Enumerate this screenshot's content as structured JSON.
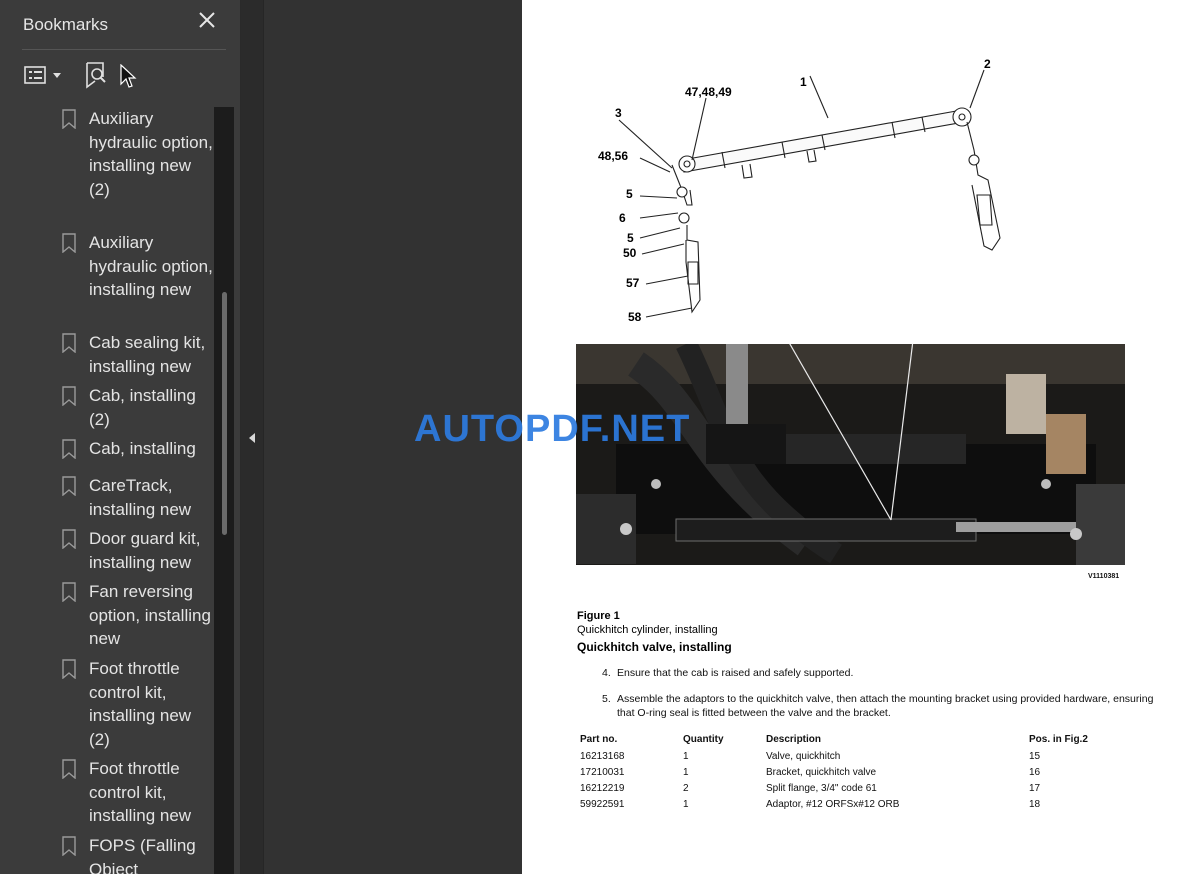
{
  "sidebar": {
    "title": "Bookmarks",
    "close_icon": "close-icon",
    "options_icon": "list-options-icon",
    "find_icon": "find-bookmark-icon",
    "items": [
      {
        "label": "Auxiliary hydraulic option, installing new (2)"
      },
      {
        "label": "Auxiliary hydraulic option, installing new"
      },
      {
        "label": "Cab sealing kit, installing new"
      },
      {
        "label": "Cab, installing (2)"
      },
      {
        "label": "Cab, installing"
      },
      {
        "label": "CareTrack, installing new"
      },
      {
        "label": "Door guard kit, installing new"
      },
      {
        "label": "Fan reversing option, installing new"
      },
      {
        "label": "Foot throttle control kit, installing new (2)"
      },
      {
        "label": "Foot throttle control kit, installing new"
      },
      {
        "label": "FOPS (Falling Object"
      }
    ]
  },
  "document": {
    "watermark": "AUTOPDF.NET",
    "callouts": {
      "c1": "1",
      "c2": "2",
      "c3": "3",
      "c4749": "47,48,49",
      "c4856": "48,56",
      "c5a": "5",
      "c6": "6",
      "c5b": "5",
      "c50": "50",
      "c57": "57",
      "c58": "58"
    },
    "figure_code": "V1110381",
    "figure_label": "Figure 1",
    "figure_caption": "Quickhitch cylinder, installing",
    "section_heading": "Quickhitch valve, installing",
    "steps": [
      {
        "num": "4.",
        "text": "Ensure that the cab is raised and safely supported."
      },
      {
        "num": "5.",
        "line1": "Assemble the adaptors to the quickhitch valve, then attach the mounting bracket using provided hardware, ensuring",
        "line2": "that O-ring seal is fitted between the valve and the bracket."
      }
    ],
    "table": {
      "headers": [
        "Part no.",
        "Quantity",
        "Description",
        "Pos. in Fig.2"
      ],
      "rows": [
        [
          "16213168",
          "1",
          "Valve, quickhitch",
          "15"
        ],
        [
          "17210031",
          "1",
          "Bracket, quickhitch valve",
          "16"
        ],
        [
          "16212219",
          "2",
          "Split flange, 3/4\" code 61",
          "17"
        ],
        [
          "59922591",
          "1",
          "Adaptor, #12 ORFSx#12 ORB",
          "18"
        ]
      ]
    }
  },
  "colors": {
    "sidebar_bg": "#3b3b3b",
    "viewer_bg": "#323232",
    "watermark": "#2d7be0"
  }
}
